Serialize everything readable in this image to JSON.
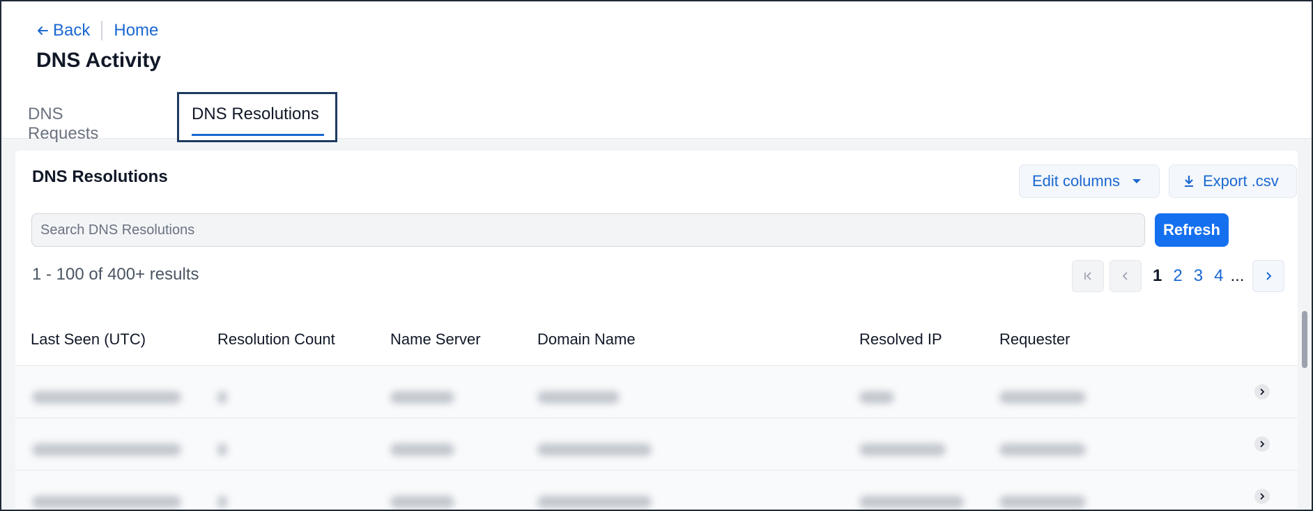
{
  "breadcrumb": {
    "back_label": "Back",
    "home_label": "Home"
  },
  "page": {
    "title": "DNS Activity"
  },
  "tabs": [
    {
      "label": "DNS Requests",
      "active": false
    },
    {
      "label": "DNS Resolutions",
      "active": true
    }
  ],
  "panel": {
    "title": "DNS Resolutions",
    "edit_columns_label": "Edit columns",
    "export_label": "Export .csv",
    "search_placeholder": "Search DNS Resolutions",
    "refresh_label": "Refresh",
    "results_text": "1 - 100 of 400+ results"
  },
  "pagination": {
    "pages": [
      "1",
      "2",
      "3",
      "4"
    ],
    "current": "1",
    "ellipsis": "..."
  },
  "table": {
    "columns": [
      "Last Seen (UTC)",
      "Resolution Count",
      "Name Server",
      "Domain Name",
      "Resolved IP",
      "Requester"
    ],
    "rows_note": "values blurred in screenshot"
  },
  "colors": {
    "accent": "#1a67d2",
    "primary_button": "#1570ef",
    "highlight_border": "#1e3a5f"
  }
}
